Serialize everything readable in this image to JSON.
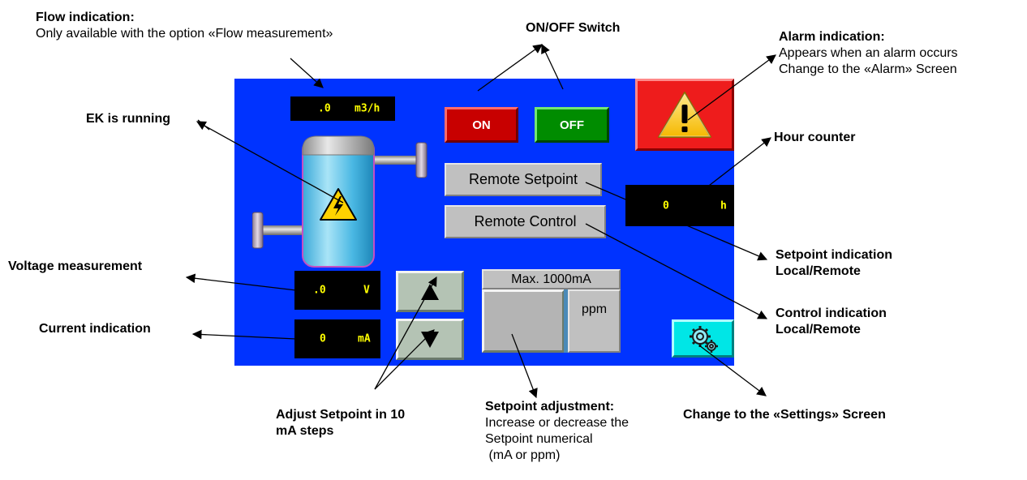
{
  "annotations": {
    "flow": {
      "title": "Flow indication:",
      "desc": "Only available with the option «Flow measurement»"
    },
    "onoff": {
      "title": "ON/OFF Switch"
    },
    "alarm": {
      "title": "Alarm indication:",
      "line1": "Appears when an alarm occurs",
      "line2": "Change to the «Alarm» Screen"
    },
    "ek_running": {
      "title": "EK is running"
    },
    "hour_counter": {
      "title": "Hour counter"
    },
    "voltage": {
      "title": "Voltage measurement"
    },
    "current": {
      "title": "Current indication"
    },
    "setpoint_indication": {
      "line1": "Setpoint indication",
      "line2": "Local/Remote"
    },
    "control_indication": {
      "line1": "Control indication",
      "line2": "Local/Remote"
    },
    "adjust_setpoint": {
      "line1": "Adjust Setpoint in 10",
      "line2": "mA steps"
    },
    "setpoint_adjustment": {
      "title": "Setpoint adjustment:",
      "line1": "Increase or decrease the",
      "line2": "Setpoint numerical",
      "line3": " (mA or ppm)"
    },
    "settings": {
      "title": "Change to the «Settings» Screen"
    }
  },
  "hmi": {
    "flow_display": {
      "value": ".0",
      "unit": "m3/h"
    },
    "on_button": "ON",
    "off_button": "OFF",
    "remote_setpoint": "Remote Setpoint",
    "remote_control": "Remote Control",
    "hour_display": {
      "value": "0",
      "unit": "h"
    },
    "voltage_display": {
      "value": ".0",
      "unit": "V"
    },
    "current_display": {
      "value": "0",
      "unit": "mA"
    },
    "max_label": "Max. 1000mA",
    "ppm_label": "ppm"
  },
  "colors": {
    "panel_bg": "#0033ff",
    "display_bg": "#000000",
    "display_text": "#ffff00",
    "on_button": "#c80000",
    "off_button": "#008c00",
    "alarm_button": "#ee1c1c",
    "settings_button": "#00e6e6"
  },
  "icons": {
    "alarm": "warning-triangle-icon",
    "settings": "gears-icon",
    "ek": "electrolysis-tank-icon",
    "up": "arrow-up-icon",
    "down": "arrow-down-icon"
  }
}
